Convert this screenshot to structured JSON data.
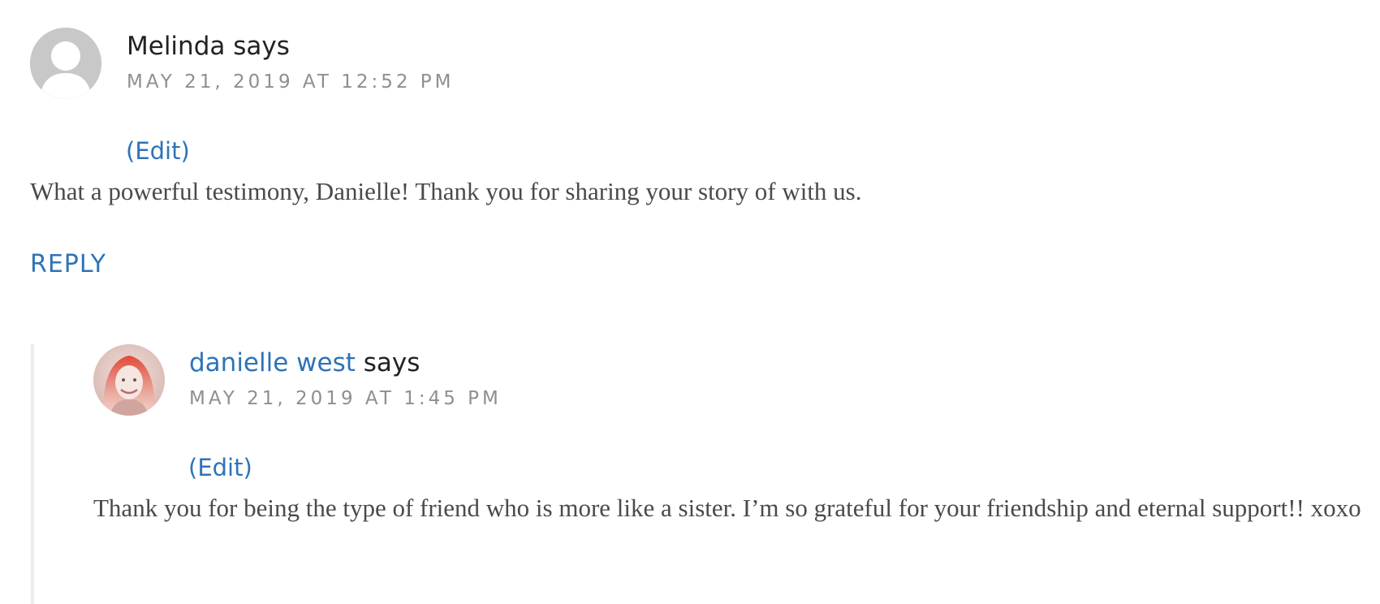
{
  "comments": [
    {
      "author": "Melinda",
      "author_is_link": false,
      "says": "says",
      "date": "MAY 21, 2019 AT 12:52 PM",
      "edit_label": "(Edit)",
      "body": "What a powerful testimony, Danielle! Thank you for sharing your story of with us.",
      "reply_label": "REPLY",
      "avatar_icon": "default-avatar-icon"
    },
    {
      "author": "danielle west",
      "author_is_link": true,
      "says": "says",
      "date": "MAY 21, 2019 AT 1:45 PM",
      "edit_label": "(Edit)",
      "body": "Thank you for being the type of friend who is more like a sister. I’m so grateful for your friendship and eternal support!! xoxo",
      "avatar_icon": "user-photo-avatar"
    }
  ],
  "colors": {
    "link": "#2e73b8",
    "date": "#8f8f8f",
    "body_text": "#4a4a4a",
    "author": "#222222",
    "default_avatar": "#c8c8c8",
    "thread_border": "#ececec"
  }
}
